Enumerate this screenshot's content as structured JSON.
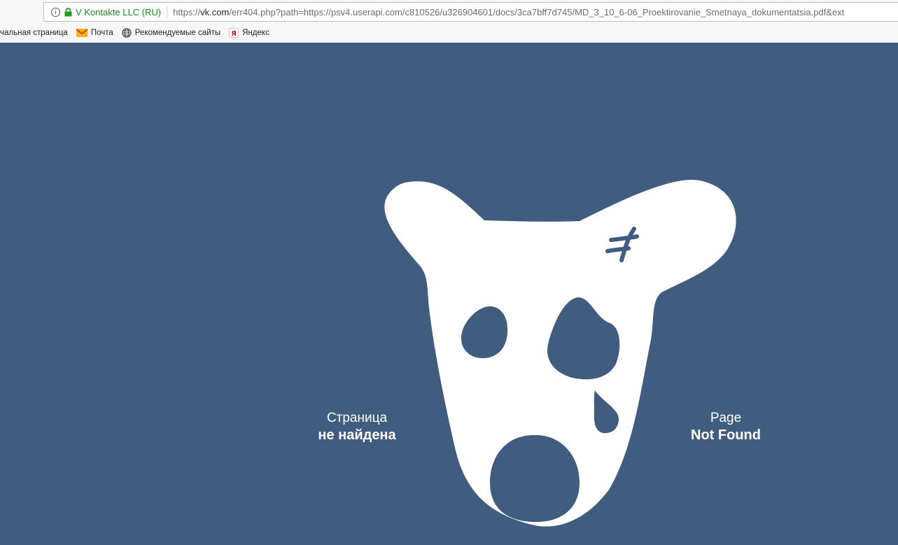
{
  "browser": {
    "site_identity": "V Kontakte LLC (RU)",
    "url_prefix": "https://",
    "url_host": "vk.com",
    "url_rest": "/err404.php?path=https://psv4.userapi.com/c810526/u326904601/docs/3ca7bff7d745/MD_3_10_6-06_Proektirovanie_Smetnaya_dokumentatsia.pdf&ext",
    "bookmarks": [
      {
        "label": "чальная страница",
        "icon": ""
      },
      {
        "label": "Почта",
        "icon": "mail-icon"
      },
      {
        "label": "Рекомендуемые сайты",
        "icon": "globe-icon"
      },
      {
        "label": "Яндекс",
        "icon": "yandex-icon"
      }
    ]
  },
  "error": {
    "ru_line1": "Страница",
    "ru_line2": "не найдена",
    "en_line1": "Page",
    "en_line2": "Not Found"
  },
  "colors": {
    "background": "#405d80",
    "dog": "#ffffff",
    "secure": "#1e8a1e"
  }
}
